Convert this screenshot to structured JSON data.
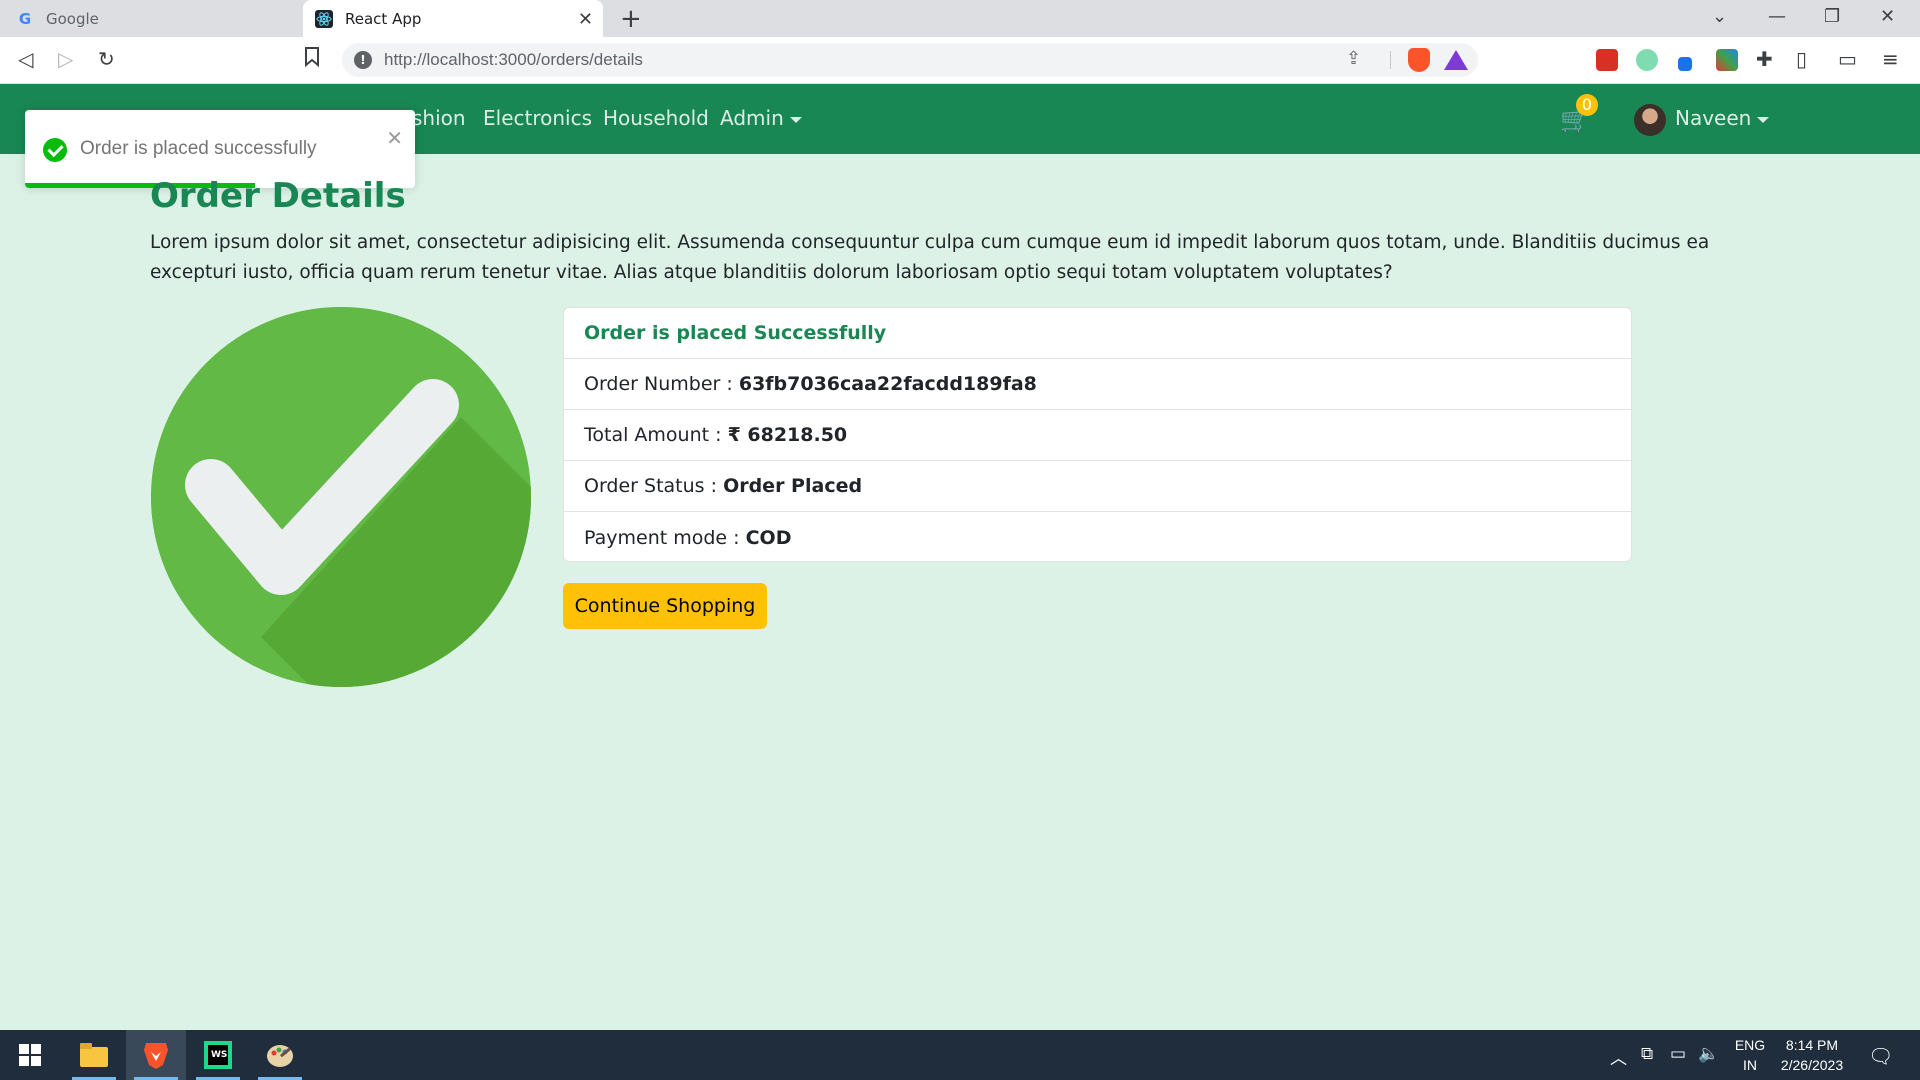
{
  "browser": {
    "tabs": [
      {
        "title": "Google",
        "active": false
      },
      {
        "title": "React App",
        "active": true
      }
    ],
    "url": "http://localhost:3000/orders/details"
  },
  "navbar": {
    "links": [
      "shion",
      "Electronics",
      "Household",
      "Admin"
    ],
    "cart_count": "0",
    "user_name": "Naveen"
  },
  "toast": {
    "message": "Order is placed successfully",
    "progress": 0.59
  },
  "page": {
    "title": "Order Details",
    "description": "Lorem ipsum dolor sit amet, consectetur adipisicing elit. Assumenda consequuntur culpa cum cumque eum id impedit laborum quos totam, unde. Blanditiis ducimus ea excepturi iusto, officia quam rerum tenetur vitae. Alias atque blanditiis dolorum laboriosam optio sequi totam voluptatem voluptates?"
  },
  "order": {
    "header": "Order is placed Successfully",
    "number_label": "Order Number : ",
    "number_value": "63fb7036caa22facdd189fa8",
    "amount_label": "Total Amount : ",
    "amount_value": "₹ 68218.50",
    "status_label": "Order Status : ",
    "status_value": "Order Placed",
    "payment_label": "Payment mode : ",
    "payment_value": "COD"
  },
  "actions": {
    "continue_label": "Continue Shopping"
  },
  "taskbar": {
    "lang_top": "ENG",
    "lang_bottom": "IN",
    "time": "8:14 PM",
    "date": "2/26/2023"
  },
  "colors": {
    "brand_green": "#198754",
    "page_bg": "#dcf2e7",
    "button_yellow": "#ffc107",
    "check_green": "#62b946",
    "toast_green": "#07bc0c"
  }
}
